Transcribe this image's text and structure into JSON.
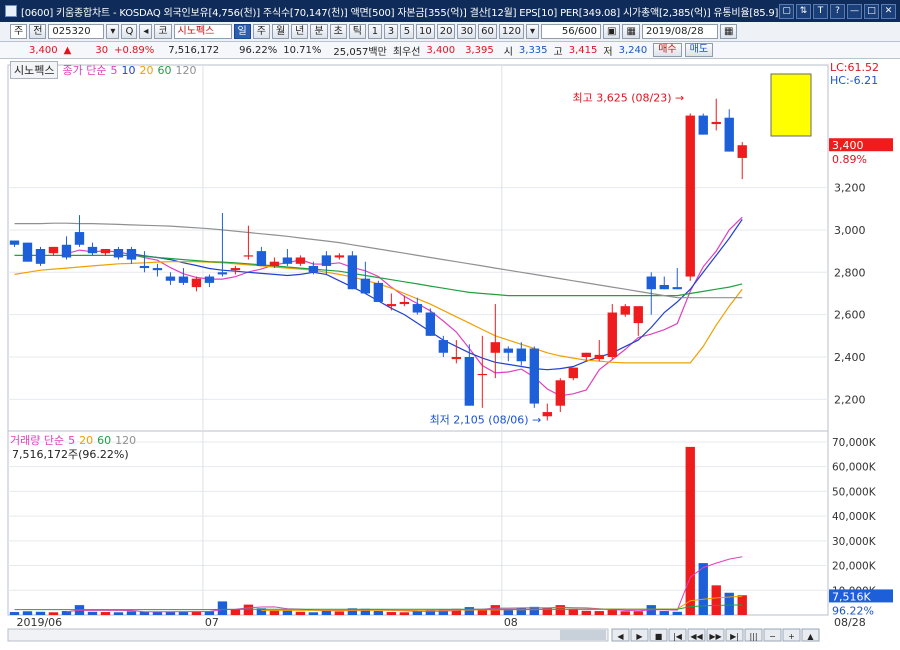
{
  "window": {
    "title": "[0600] 키움종합차트 - KOSDAQ 외국인보유[4,756(천)] 주식수[70,147(천)] 액면[500] 자본금[355(억)] 결산[12월] EPS[10] PER[349.08] 시가총액[2,385(억)] 유통비율[85.9]",
    "controls": [
      "▢",
      "⇅",
      "T",
      "?",
      "—",
      "□",
      "✕"
    ]
  },
  "toolbar": {
    "type_select": "주",
    "all_label": "전",
    "code": "025320",
    "name_button": "코",
    "name_value": "시노펙스",
    "period_buttons": [
      "일",
      "주",
      "월",
      "년",
      "분",
      "초",
      "틱"
    ],
    "selected_period": "일",
    "intervals": [
      "1",
      "3",
      "5",
      "10",
      "20",
      "30",
      "60",
      "120"
    ],
    "count": "56/600",
    "date": "2019/08/28"
  },
  "quote": {
    "price": "3,400",
    "arrow": "▲",
    "change": "30",
    "change_rate": "+0.89%",
    "volume": "7,516,172",
    "volume_ratio": "96.22%",
    "turnover": "10.71%",
    "amount": "25,057백만",
    "best_label": "최우선",
    "ask": "3,400",
    "bid": "3,395",
    "open_label": "시",
    "open": "3,335",
    "high_label": "고",
    "high": "3,415",
    "low_label": "저",
    "low": "3,240",
    "buy_button": "매수",
    "sell_button": "매도"
  },
  "price_legend": {
    "name": "시노펙스",
    "label": "종가 단순",
    "ma": [
      "5",
      "10",
      "20",
      "60",
      "120"
    ]
  },
  "volume_legend": {
    "label": "거래량 단순",
    "ma": [
      "5",
      "20",
      "60",
      "120"
    ],
    "value": "7,516,172주(96.22%)"
  },
  "colors": {
    "up": "#ee1c1c",
    "down": "#1d5fd8",
    "ma5": "#e040c0",
    "ma10": "#2040d0",
    "ma20": "#f0a000",
    "ma60": "#20a040",
    "ma120": "#909090"
  },
  "chart_data": {
    "type": "candlestick",
    "price_axis": {
      "ticks": [
        "3,200",
        "3,000",
        "2,800",
        "2,600",
        "2,400",
        "2,200"
      ],
      "tick_values": [
        3200,
        3000,
        2800,
        2600,
        2400,
        2200
      ],
      "ylim": [
        2060,
        3760
      ]
    },
    "volume_axis": {
      "ticks": [
        "70,000K",
        "60,000K",
        "50,000K",
        "40,000K",
        "30,000K",
        "20,000K",
        "10,000K"
      ],
      "tick_values": [
        70000,
        60000,
        50000,
        40000,
        30000,
        20000,
        10000
      ],
      "ylim": [
        0,
        72000
      ]
    },
    "x_labels": [
      {
        "label": "2019/06",
        "index": 0
      },
      {
        "label": "07",
        "index": 14.5
      },
      {
        "label": "08",
        "index": 37.5
      },
      {
        "label": "08/28",
        "index": 62.2
      }
    ],
    "index_range": [
      -0.5,
      62.6
    ],
    "candles": [
      [
        2950,
        2950,
        2920,
        2930,
        1200
      ],
      [
        2940,
        2940,
        2850,
        2850,
        1500
      ],
      [
        2910,
        2920,
        2830,
        2840,
        1300
      ],
      [
        2890,
        2920,
        2880,
        2920,
        1100
      ],
      [
        2930,
        2970,
        2860,
        2870,
        1600
      ],
      [
        2990,
        3070,
        2920,
        2930,
        4000
      ],
      [
        2920,
        2940,
        2880,
        2890,
        1300
      ],
      [
        2890,
        2910,
        2880,
        2910,
        1200
      ],
      [
        2910,
        2920,
        2860,
        2870,
        1100
      ],
      [
        2910,
        2920,
        2840,
        2860,
        1500
      ],
      [
        2830,
        2900,
        2800,
        2820,
        1400
      ],
      [
        2820,
        2840,
        2780,
        2810,
        1300
      ],
      [
        2780,
        2800,
        2740,
        2760,
        1400
      ],
      [
        2780,
        2820,
        2740,
        2750,
        1200
      ],
      [
        2730,
        2780,
        2710,
        2770,
        1500
      ],
      [
        2780,
        2790,
        2730,
        2750,
        1600
      ],
      [
        2800,
        3080,
        2780,
        2790,
        5500
      ],
      [
        2810,
        2830,
        2790,
        2820,
        2200
      ],
      [
        2880,
        3020,
        2860,
        2880,
        4200
      ],
      [
        2900,
        2920,
        2830,
        2830,
        2700
      ],
      [
        2830,
        2870,
        2820,
        2850,
        1800
      ],
      [
        2870,
        2910,
        2830,
        2840,
        1900
      ],
      [
        2840,
        2880,
        2830,
        2870,
        1300
      ],
      [
        2830,
        2850,
        2790,
        2800,
        1100
      ],
      [
        2880,
        2900,
        2790,
        2830,
        1900
      ],
      [
        2870,
        2890,
        2860,
        2880,
        1400
      ],
      [
        2880,
        2900,
        2720,
        2720,
        2700
      ],
      [
        2770,
        2850,
        2700,
        2700,
        2500
      ],
      [
        2750,
        2760,
        2660,
        2660,
        1600
      ],
      [
        2640,
        2700,
        2620,
        2650,
        1200
      ],
      [
        2650,
        2690,
        2640,
        2660,
        1100
      ],
      [
        2650,
        2680,
        2600,
        2610,
        1500
      ],
      [
        2610,
        2630,
        2500,
        2500,
        1800
      ],
      [
        2480,
        2500,
        2400,
        2420,
        2200
      ],
      [
        2390,
        2480,
        2370,
        2400,
        2500
      ],
      [
        2400,
        2460,
        2170,
        2170,
        3200
      ],
      [
        2320,
        2500,
        2160,
        2320,
        2100
      ],
      [
        2420,
        2650,
        2300,
        2470,
        4000
      ],
      [
        2440,
        2450,
        2380,
        2420,
        2100
      ],
      [
        2440,
        2470,
        2360,
        2380,
        3000
      ],
      [
        2440,
        2450,
        2160,
        2180,
        3300
      ],
      [
        2120,
        2180,
        2100,
        2140,
        2900
      ],
      [
        2170,
        2300,
        2140,
        2290,
        4000
      ],
      [
        2300,
        2340,
        2290,
        2350,
        2500
      ],
      [
        2400,
        2420,
        2380,
        2420,
        1700
      ],
      [
        2390,
        2480,
        2380,
        2410,
        1600
      ],
      [
        2400,
        2650,
        2390,
        2610,
        2000
      ],
      [
        2600,
        2650,
        2590,
        2640,
        1500
      ],
      [
        2560,
        2590,
        2500,
        2640,
        1500
      ],
      [
        2780,
        2800,
        2600,
        2720,
        4000
      ],
      [
        2740,
        2780,
        2720,
        2720,
        1600
      ],
      [
        2730,
        2820,
        2720,
        2720,
        1300
      ],
      [
        2780,
        3550,
        2760,
        3540,
        68000
      ],
      [
        3540,
        3550,
        3450,
        3450,
        21000
      ],
      [
        3500,
        3620,
        3470,
        3510,
        12000
      ],
      [
        3530,
        3570,
        3370,
        3370,
        9000
      ],
      [
        3340,
        3415,
        3240,
        3400,
        8000
      ]
    ],
    "series": [
      {
        "name": "5",
        "values": [
          null,
          null,
          null,
          null,
          2888,
          2905,
          2897,
          2901,
          2896,
          2884,
          2869,
          2857,
          2822,
          2793,
          2776,
          2768,
          2768,
          2779,
          2802,
          2815,
          2836,
          2845,
          2859,
          2839,
          2838,
          2845,
          2823,
          2807,
          2780,
          2729,
          2686,
          2652,
          2618,
          2570,
          2518,
          2440,
          2360,
          2325,
          2329,
          2343,
          2305,
          2249,
          2217,
          2226,
          2244,
          2340,
          2388,
          2436,
          2492,
          2508,
          2529,
          2558,
          2711,
          2826,
          2900,
          3000,
          3060
        ]
      },
      {
        "name": "10",
        "values": [
          null,
          null,
          null,
          null,
          null,
          null,
          null,
          null,
          null,
          2887,
          2878,
          2870,
          2860,
          2845,
          2832,
          2818,
          2810,
          2805,
          2800,
          2795,
          2790,
          2785,
          2790,
          2800,
          2790,
          2760,
          2730,
          2700,
          2665,
          2630,
          2600,
          2560,
          2520,
          2480,
          2450,
          2420,
          2395,
          2375,
          2365,
          2355,
          2345,
          2340,
          2345,
          2355,
          2380,
          2400,
          2420,
          2450,
          2480,
          2540,
          2610,
          2660,
          2720,
          2800,
          2880,
          2960,
          3050
        ]
      },
      {
        "name": "20",
        "values": [
          2790,
          2800,
          2810,
          2815,
          2820,
          2825,
          2830,
          2835,
          2840,
          2842,
          2845,
          2848,
          2850,
          2850,
          2850,
          2848,
          2845,
          2840,
          2835,
          2830,
          2825,
          2820,
          2815,
          2810,
          2800,
          2790,
          2778,
          2762,
          2745,
          2725,
          2700,
          2675,
          2650,
          2620,
          2590,
          2560,
          2530,
          2500,
          2480,
          2460,
          2440,
          2420,
          2405,
          2395,
          2385,
          2380,
          2375,
          2372,
          2372,
          2372,
          2372,
          2372,
          2372,
          2450,
          2550,
          2640,
          2720
        ]
      },
      {
        "name": "60",
        "values": [
          2880,
          2880,
          2880,
          2880,
          2880,
          2880,
          2880,
          2880,
          2880,
          2880,
          2875,
          2870,
          2865,
          2860,
          2855,
          2850,
          2848,
          2845,
          2840,
          2835,
          2830,
          2825,
          2820,
          2815,
          2810,
          2805,
          2795,
          2785,
          2775,
          2765,
          2755,
          2745,
          2735,
          2725,
          2715,
          2705,
          2700,
          2695,
          2690,
          2690,
          2690,
          2690,
          2690,
          2690,
          2690,
          2690,
          2690,
          2690,
          2690,
          2690,
          2690,
          2690,
          2700,
          2710,
          2720,
          2730,
          2745
        ]
      },
      {
        "name": "120",
        "values": [
          3030,
          3030,
          3030,
          3032,
          3032,
          3030,
          3030,
          3028,
          3026,
          3024,
          3022,
          3020,
          3018,
          3014,
          3010,
          3006,
          3000,
          2994,
          2988,
          2982,
          2976,
          2970,
          2962,
          2955,
          2948,
          2940,
          2930,
          2920,
          2910,
          2900,
          2890,
          2880,
          2870,
          2860,
          2850,
          2840,
          2830,
          2820,
          2810,
          2800,
          2790,
          2780,
          2770,
          2760,
          2750,
          2740,
          2730,
          2720,
          2710,
          2700,
          2690,
          2680,
          2680,
          2680,
          2680,
          2680,
          2680
        ]
      }
    ],
    "volume_ma": [
      {
        "name": "5",
        "values": [
          null,
          null,
          null,
          null,
          1340,
          1900,
          1860,
          1860,
          1880,
          1820,
          1320,
          1300,
          1340,
          1360,
          1360,
          1400,
          2240,
          2360,
          2860,
          3240,
          3280,
          2560,
          2380,
          2000,
          1760,
          1680,
          1840,
          1960,
          2020,
          1880,
          1720,
          1480,
          1440,
          1560,
          1840,
          2340,
          2360,
          2800,
          2780,
          2880,
          2900,
          2880,
          3060,
          2960,
          2880,
          2500,
          2220,
          1860,
          1660,
          2120,
          2120,
          1980,
          15280,
          19180,
          20980,
          22600,
          23600
        ]
      },
      {
        "name": "20",
        "values": [
          null,
          null,
          null,
          null,
          null,
          null,
          null,
          null,
          null,
          null,
          null,
          null,
          null,
          null,
          null,
          null,
          null,
          null,
          null,
          1800,
          1850,
          1860,
          1870,
          1880,
          1890,
          1900,
          1910,
          1920,
          1930,
          1940,
          1950,
          1960,
          1970,
          1990,
          2010,
          2030,
          2050,
          2080,
          2100,
          2150,
          2200,
          2250,
          2300,
          2350,
          2380,
          2400,
          2420,
          2400,
          2380,
          2400,
          2420,
          2440,
          5800,
          6400,
          6900,
          7300,
          7600
        ]
      },
      {
        "name": "60",
        "values": [
          2200,
          2200,
          2200,
          2200,
          2200,
          2200,
          2200,
          2200,
          2200,
          2200,
          2200,
          2200,
          2200,
          2200,
          2200,
          2200,
          2250,
          2250,
          2300,
          2300,
          2300,
          2300,
          2300,
          2300,
          2300,
          2300,
          2300,
          2300,
          2300,
          2300,
          2300,
          2300,
          2300,
          2300,
          2300,
          2300,
          2300,
          2300,
          2300,
          2300,
          2300,
          2300,
          2300,
          2300,
          2300,
          2300,
          2300,
          2300,
          2300,
          2300,
          2300,
          2300,
          3400,
          3700,
          3900,
          4000,
          4100
        ]
      }
    ],
    "annotations": {
      "high": {
        "text": "최고 3,625 (08/23)",
        "index": 52,
        "value": 3625
      },
      "low": {
        "text": "최저 2,105 (08/06)",
        "index": 41,
        "value": 2105
      },
      "lc": "LC:61.52",
      "hc": "HC:-6.21",
      "last_price": "3,400",
      "last_rate": "0.89%",
      "last_volume": "7,516K",
      "last_volume_rate": "96.22%"
    }
  },
  "bottom_nav": [
    "◀",
    "▶",
    "■",
    "|◀",
    "◀◀",
    "▶▶",
    "▶|",
    "|||",
    "−",
    "+",
    "▲"
  ]
}
